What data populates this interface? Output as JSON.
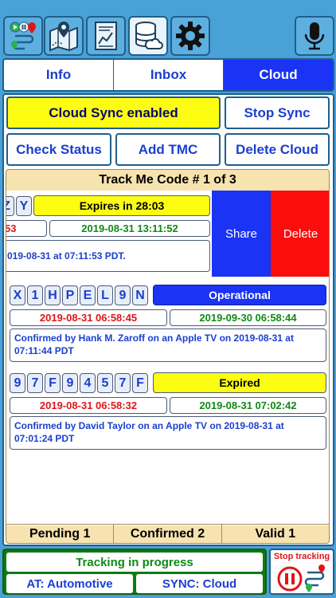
{
  "tabs": [
    {
      "label": "Info",
      "active": false
    },
    {
      "label": "Inbox",
      "active": false
    },
    {
      "label": "Cloud",
      "active": true
    }
  ],
  "cloud": {
    "sync_status": "Cloud Sync enabled",
    "stop_sync": "Stop Sync",
    "check_status": "Check Status",
    "add_tmc": "Add TMC",
    "delete_cloud": "Delete Cloud"
  },
  "list": {
    "title": "Track Me Code # 1 of 3",
    "items": [
      {
        "code": [
          "Z",
          "Y"
        ],
        "state": "Expires in 28:03",
        "start": "53",
        "end": "2019-08-31 13:11:52",
        "confirmation": "019-08-31 at 07:11:53 PDT."
      },
      {
        "code": [
          "X",
          "1",
          "H",
          "P",
          "E",
          "L",
          "9",
          "N"
        ],
        "state": "Operational",
        "start": "2019-08-31 06:58:45",
        "end": "2019-09-30 06:58:44",
        "confirmation": "Confirmed by Hank M. Zaroff on an Apple TV on 2019-08-31 at 07:11:44 PDT"
      },
      {
        "code": [
          "9",
          "7",
          "F",
          "9",
          "4",
          "5",
          "7",
          "F"
        ],
        "state": "Expired",
        "start": "2019-08-31 06:58:32",
        "end": "2019-08-31 07:02:42",
        "confirmation": "Confirmed by David Taylor on an Apple TV on 2019-08-31 at 07:01:24 PDT"
      }
    ],
    "swipe_actions": {
      "share": "Share",
      "delete": "Delete"
    },
    "counts": {
      "pending": "Pending 1",
      "confirmed": "Confirmed 2",
      "valid": "Valid 1"
    }
  },
  "status": {
    "tracking": "Tracking in progress",
    "activity": "AT: Automotive",
    "sync": "SYNC: Cloud",
    "stop_tracking": "Stop tracking"
  },
  "colors": {
    "background": "#4aa1d8",
    "accent_blue": "#1a33f5",
    "yellow": "#fdfd12",
    "red": "#e0161a",
    "green": "#0f8a14",
    "status_green": "#0f7a14"
  },
  "icons": {
    "toolbar": [
      "route-status-icon",
      "map-route-icon",
      "chart-report-icon",
      "cloud-database-icon",
      "gear-icon"
    ],
    "voice": "microphone-icon"
  }
}
